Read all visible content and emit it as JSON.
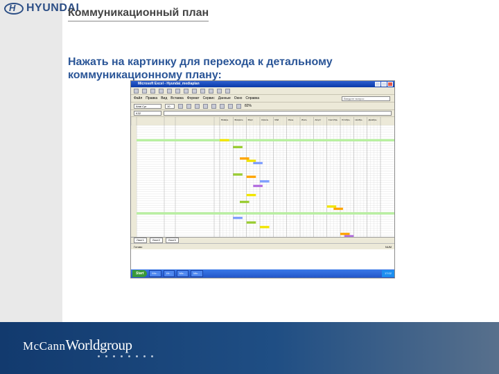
{
  "brand": {
    "logo_text": "HYUNDAI",
    "agency_prefix": "McCann",
    "agency_name": "Worldgroup"
  },
  "slide": {
    "title": "Коммуникационный план",
    "instruction": "Нажать на картинку для перехода к детальному коммуникационному плану:"
  },
  "excel": {
    "window_title": "Microsoft Excel - Hyundai_mediaplan",
    "menu": [
      "Файл",
      "Правка",
      "Вид",
      "Вставка",
      "Формат",
      "Сервис",
      "Данные",
      "Окно",
      "Справка"
    ],
    "help_placeholder": "Введите вопрос",
    "font_name": "Arial Cyr",
    "font_size": "10",
    "name_box": "K32",
    "zoom": "82%",
    "sheet_tabs": [
      "Лист1",
      "Лист2",
      "Лист3"
    ],
    "status_left": "Готово",
    "status_right": "NUM",
    "start_label": "Start",
    "taskbar_items": [
      "Mic...",
      "Ит...",
      "Mic...",
      "Mic..."
    ],
    "clock": "17:02",
    "months": [
      "Январь",
      "Февраль",
      "Март",
      "Апрель",
      "Май",
      "Июнь",
      "Июль",
      "Август",
      "Сентябрь",
      "Октябрь",
      "Ноябрь",
      "Декабрь"
    ],
    "colors": {
      "green": "#9acd32",
      "yellow": "#f2e600",
      "orange": "#ffa500",
      "blue": "#7f9fff",
      "purple": "#b46ee0",
      "lime": "#b8f0a0"
    }
  },
  "footer": {
    "color_start": "#123a6e",
    "color_end": "#58708c"
  }
}
